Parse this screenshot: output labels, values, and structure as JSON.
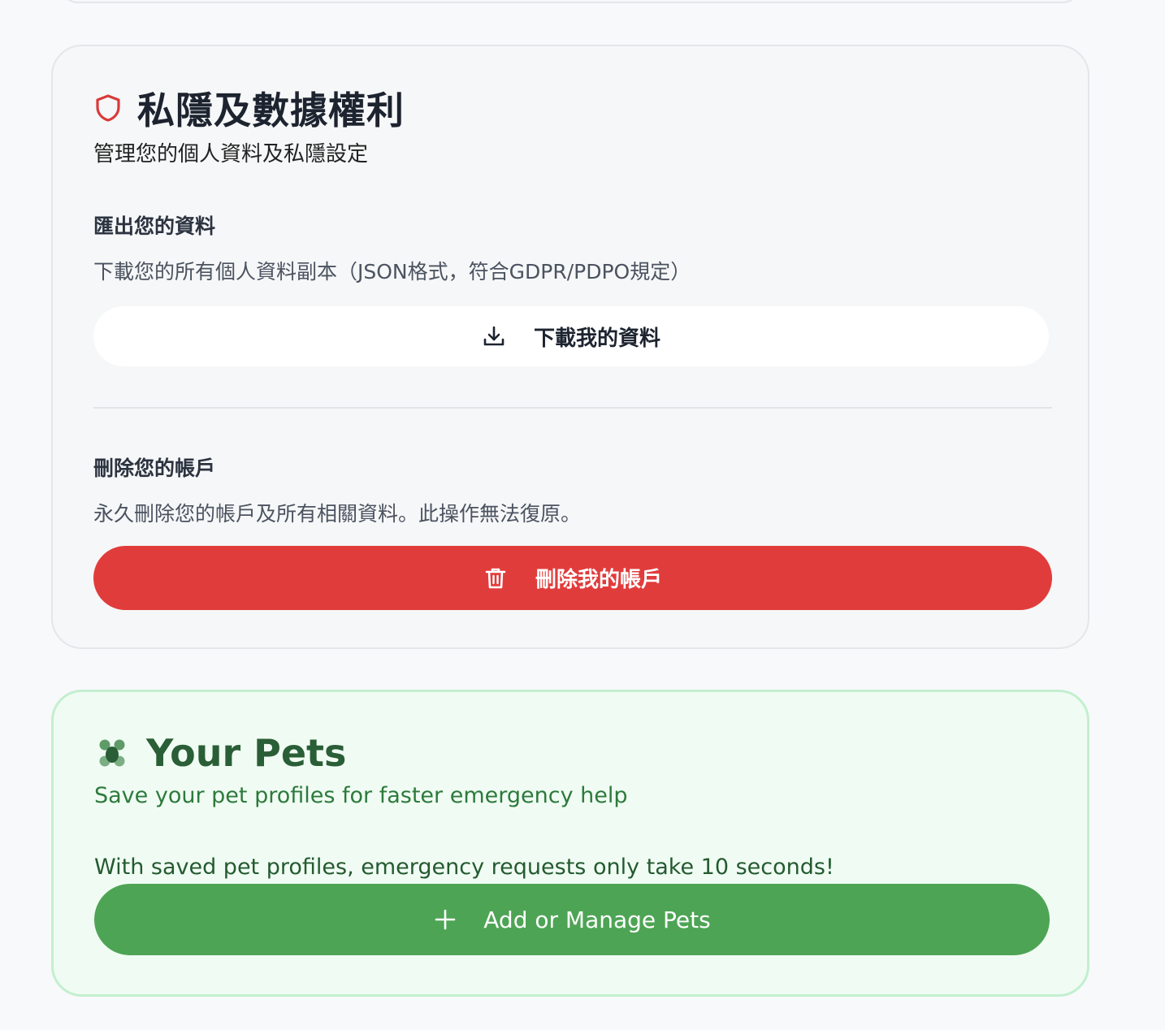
{
  "privacy": {
    "title": "私隱及數據權利",
    "subtitle": "管理您的個人資料及私隱設定",
    "export": {
      "heading": "匯出您的資料",
      "description": "下載您的所有個人資料副本（JSON格式，符合GDPR/PDPO規定）",
      "button_label": "下載我的資料"
    },
    "delete": {
      "heading": "刪除您的帳戶",
      "description": "永久刪除您的帳戶及所有相關資料。此操作無法復原。",
      "button_label": "刪除我的帳戶"
    }
  },
  "pets": {
    "title": "Your Pets",
    "subtitle": "Save your pet profiles for faster emergency help",
    "info": "With saved pet profiles, emergency requests only take 10 seconds!",
    "button_label": "Add or Manage Pets"
  },
  "colors": {
    "danger": "#e13c3c",
    "success": "#4ea455",
    "shield_icon": "#d93a3a",
    "pets_title": "#2a5e36"
  },
  "icons": {
    "privacy": "shield-icon",
    "download": "download-icon",
    "delete": "trash-icon",
    "pets": "paw-icon",
    "add": "plus-icon"
  }
}
